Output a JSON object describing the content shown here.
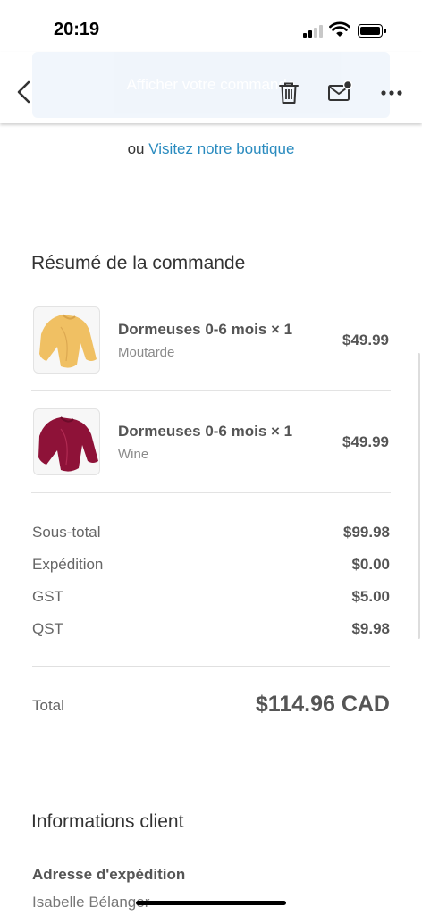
{
  "status_bar": {
    "time": "20:19"
  },
  "toolbar": {
    "cta_label": "Afficher votre commande"
  },
  "store_link": {
    "prefix": "ou",
    "link_label": "Visitez notre boutique"
  },
  "order_summary": {
    "title": "Résumé de la commande",
    "items": [
      {
        "name": "Dormeuses 0-6 mois × 1",
        "variant": "Moutarde",
        "price": "$49.99",
        "swatch": "#f0c063"
      },
      {
        "name": "Dormeuses 0-6 mois × 1",
        "variant": "Wine",
        "price": "$49.99",
        "swatch": "#8e1238"
      }
    ],
    "lines": [
      {
        "label": "Sous-total",
        "value": "$99.98"
      },
      {
        "label": "Expédition",
        "value": "$0.00"
      },
      {
        "label": "GST",
        "value": "$5.00"
      },
      {
        "label": "QST",
        "value": "$9.98"
      }
    ],
    "total_label": "Total",
    "total_value": "$114.96 CAD"
  },
  "customer_info": {
    "title": "Informations client",
    "shipping_label": "Adresse d'expédition",
    "shipping_name": "Isabelle Bélanger"
  },
  "colors": {
    "link": "#2a8bbf",
    "cta_background": "#eef4fb"
  },
  "icons": [
    "back-chevron-icon",
    "trash-icon",
    "mail-icon",
    "more-icon",
    "signal-icon",
    "wifi-icon",
    "battery-icon"
  ]
}
